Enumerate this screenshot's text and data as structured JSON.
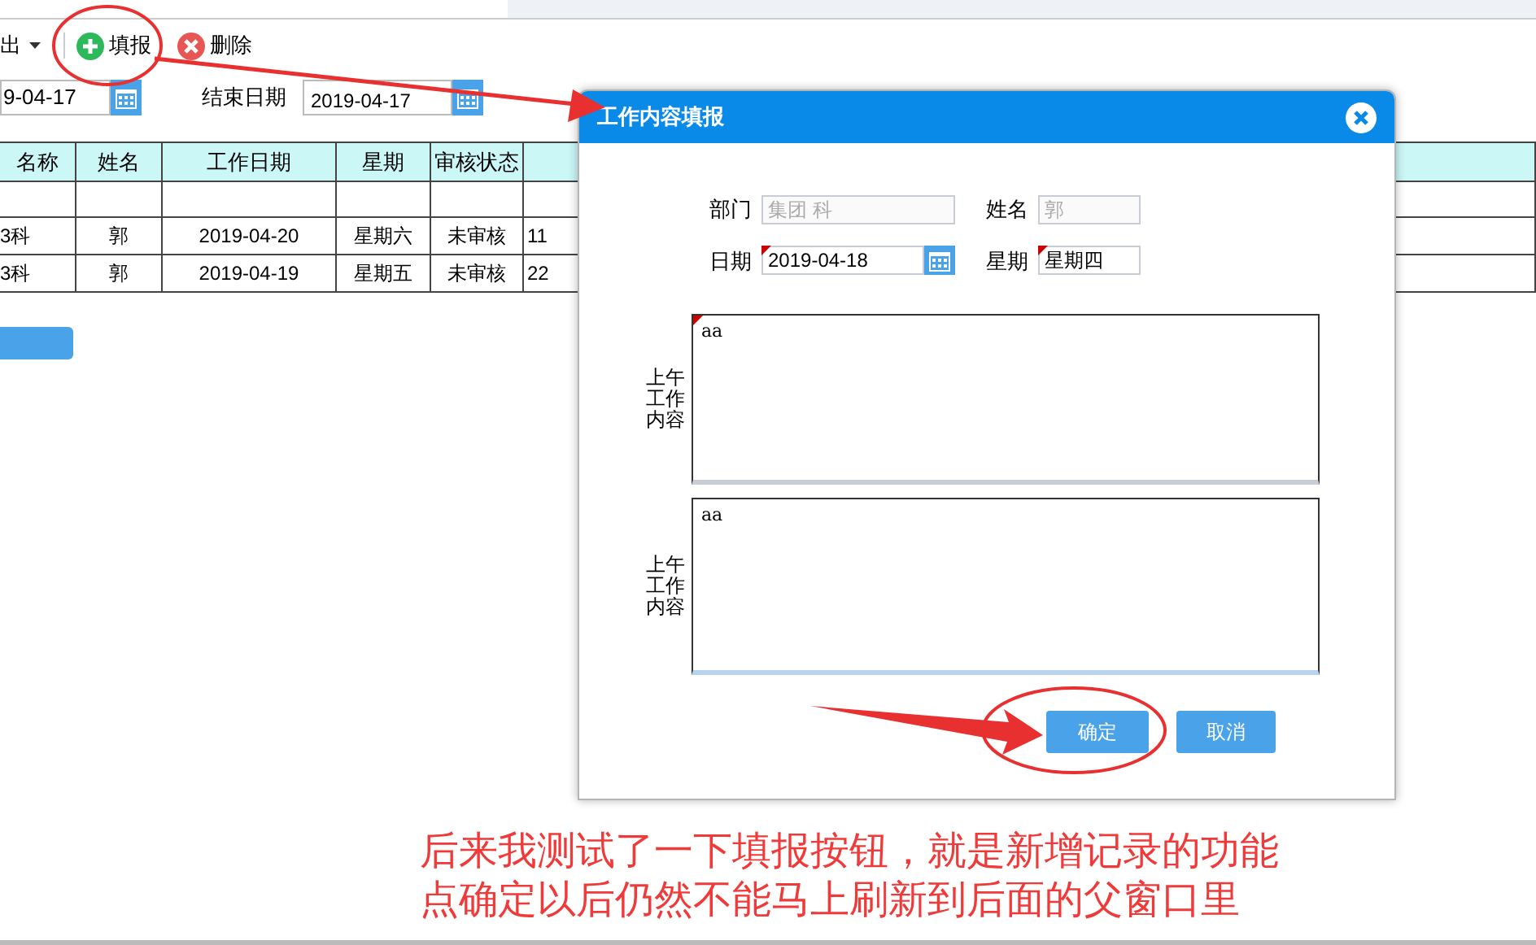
{
  "toolbar": {
    "export_label": "出",
    "buttons": [
      {
        "label": "填报",
        "kind": "add"
      },
      {
        "label": "删除",
        "kind": "delete"
      }
    ]
  },
  "filters": {
    "start_date": "9-04-17",
    "end_label": "结束日期",
    "end_date": "2019-04-17"
  },
  "table": {
    "columns": [
      "名称",
      "姓名",
      "工作日期",
      "星期",
      "审核状态"
    ],
    "rows": [
      [
        "",
        "",
        "",
        "",
        "",
        ""
      ],
      [
        "3科",
        "郭",
        "2019-04-20",
        "星期六",
        "未审核",
        "11"
      ],
      [
        "3科",
        "郭",
        "2019-04-19",
        "星期五",
        "未审核",
        "22"
      ]
    ]
  },
  "dialog": {
    "title": "工作内容填报",
    "fields": [
      {
        "label": "部门",
        "value": "集团 科",
        "disabled": true,
        "required": false,
        "kind": "text"
      },
      {
        "label": "姓名",
        "value": "郭",
        "disabled": true,
        "required": false,
        "kind": "text"
      },
      {
        "label": "日期",
        "value": "2019-04-18",
        "disabled": false,
        "required": true,
        "kind": "date"
      },
      {
        "label": "星期",
        "value": "星期四",
        "disabled": false,
        "required": true,
        "kind": "text"
      }
    ],
    "contents": [
      {
        "label": "上午工作内容",
        "value": "aa",
        "required": true
      },
      {
        "label": "上午工作内容",
        "value": "aa",
        "required": false
      }
    ],
    "buttons": [
      "确定",
      "取消"
    ]
  },
  "annotation": [
    "后来我测试了一下填报按钮，就是新增记录的功能",
    "点确定以后仍然不能马上刷新到后面的父窗口里"
  ]
}
